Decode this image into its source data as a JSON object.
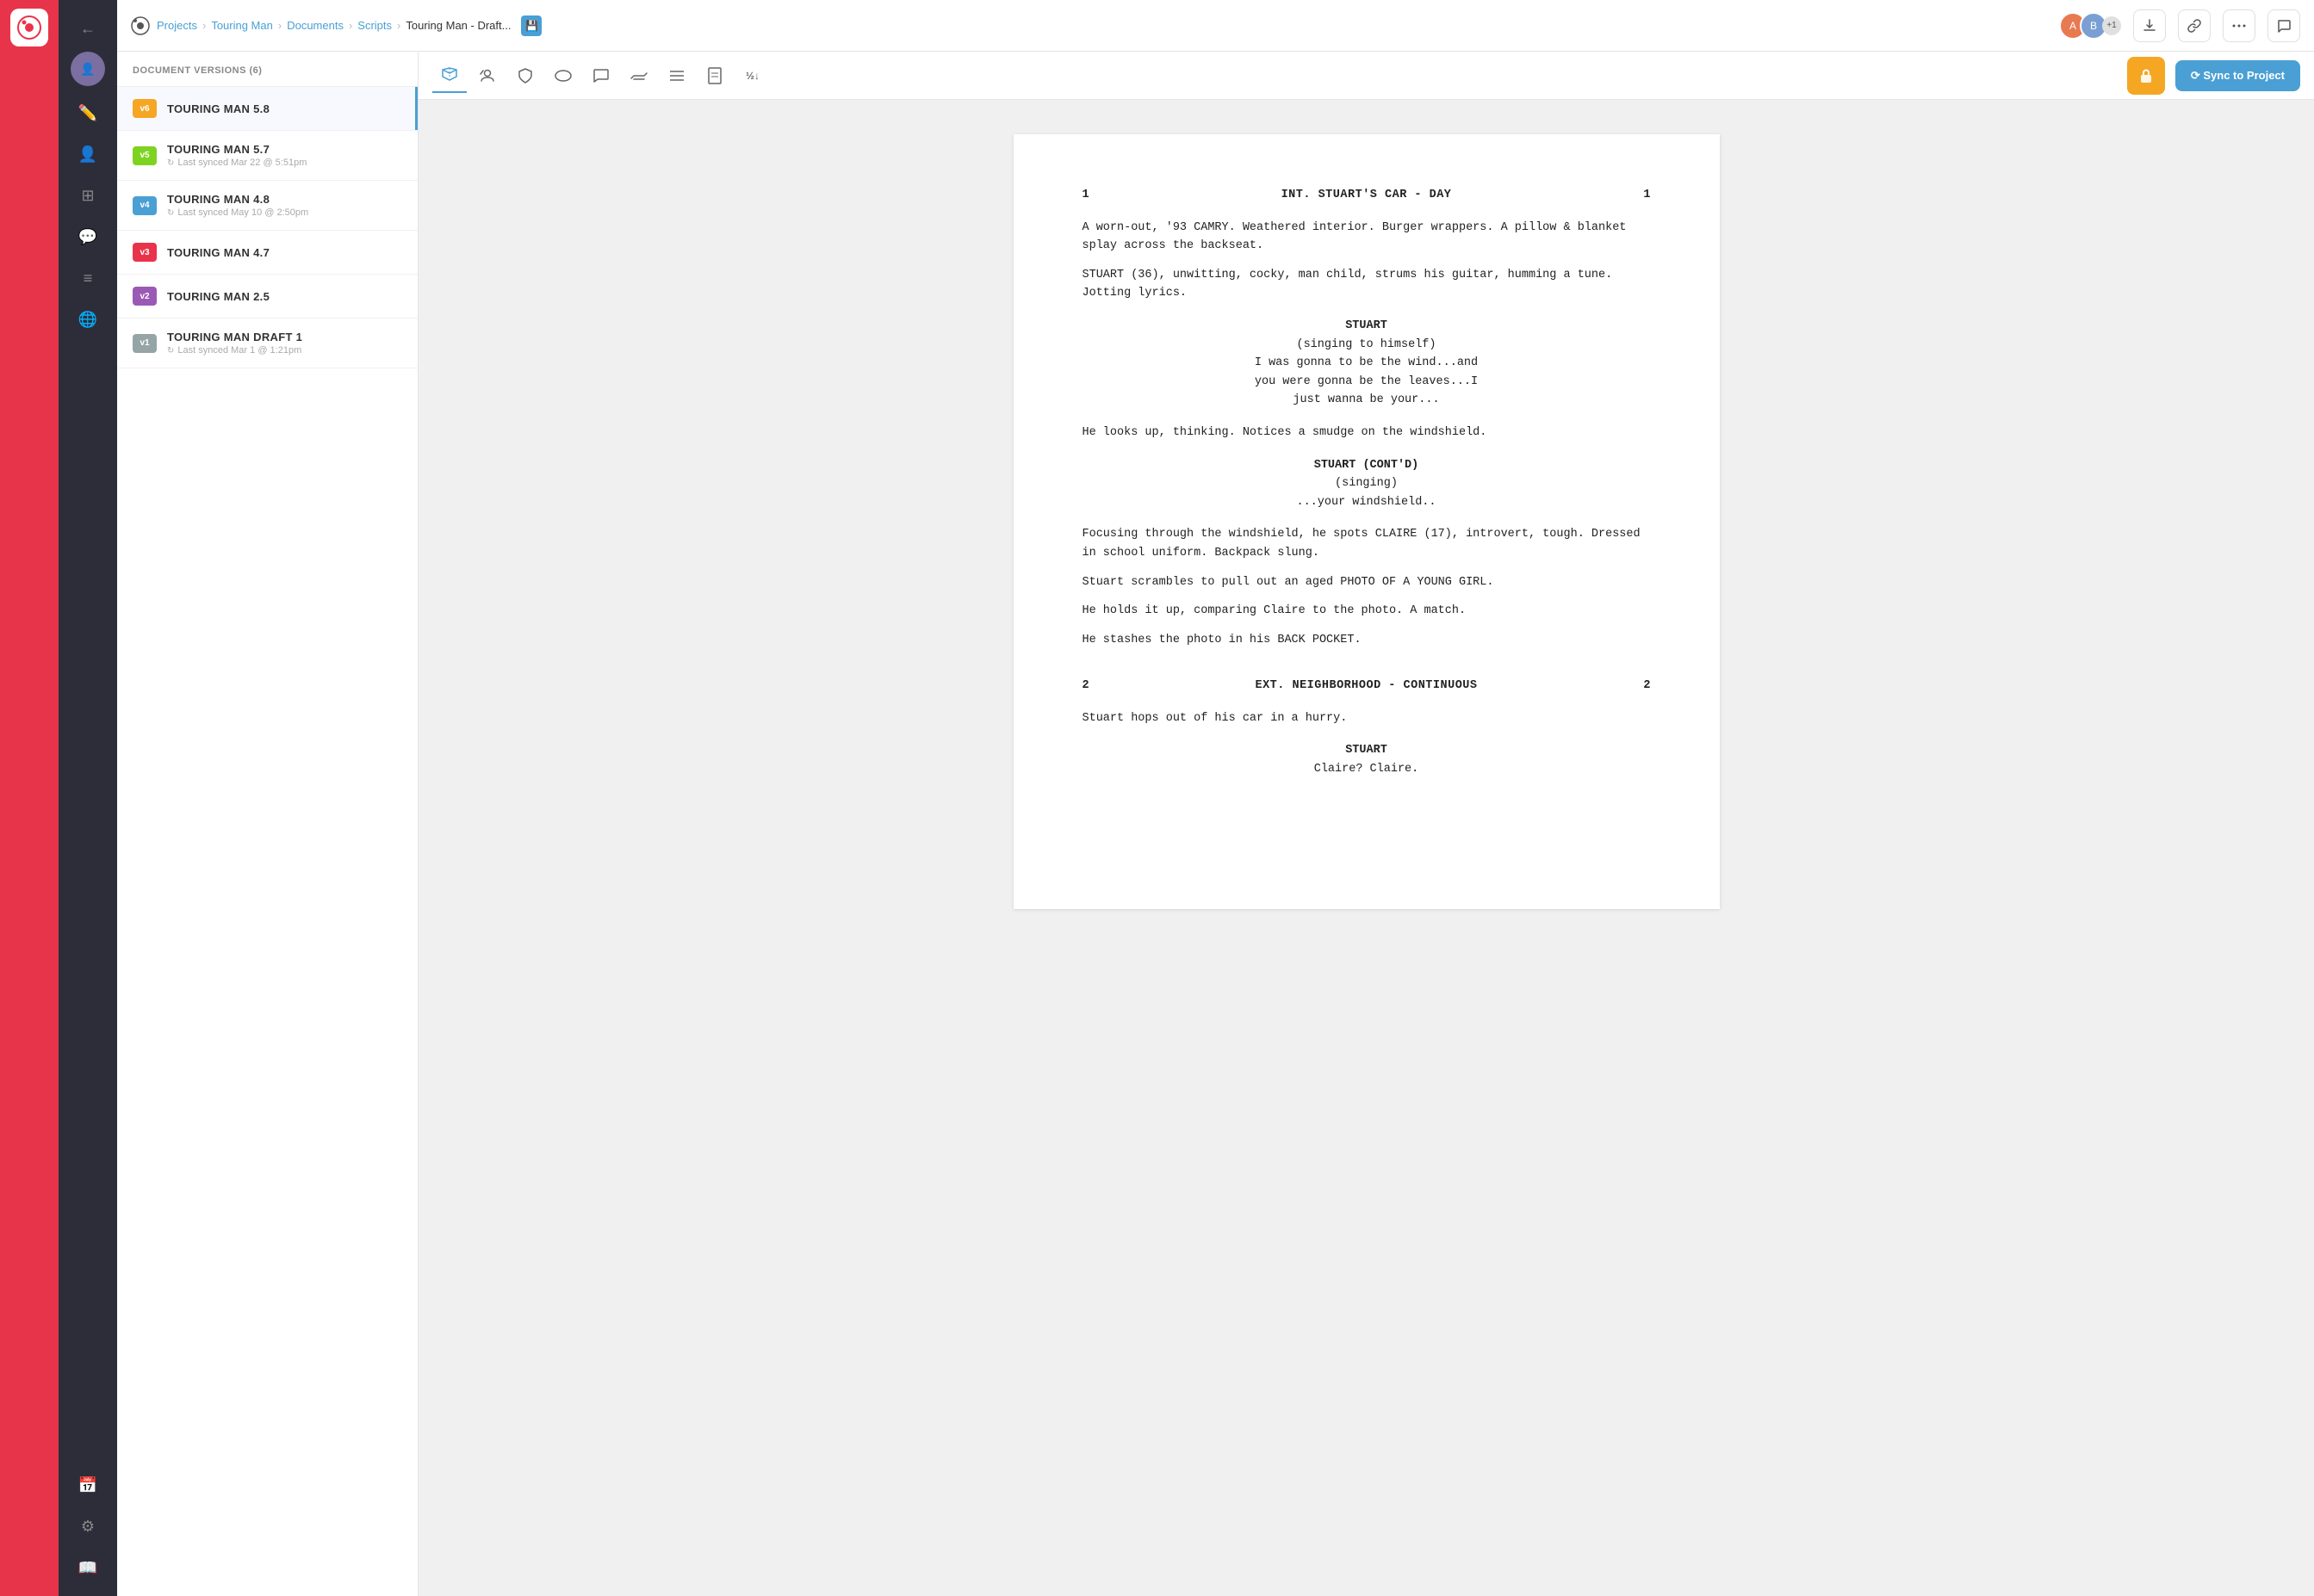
{
  "app": {
    "logo_alt": "Celtx logo"
  },
  "header": {
    "breadcrumbs": [
      "Projects",
      "Touring Man",
      "Documents",
      "Scripts",
      "Touring Man - Draft..."
    ],
    "breadcrumb_links": [
      "Projects",
      "Touring Man",
      "Documents",
      "Scripts"
    ],
    "breadcrumb_current": "Touring Man - Draft...",
    "save_icon": "💾",
    "avatars": [
      {
        "initials": "A",
        "color": "#e87a52"
      },
      {
        "initials": "B",
        "color": "#7a9fd4"
      }
    ],
    "avatar_count": "+1",
    "btn_download": "⬇",
    "btn_link": "🔗",
    "btn_more": "•••",
    "btn_chat": "💬"
  },
  "versions_panel": {
    "title": "DOCUMENT VERSIONS (6)",
    "versions": [
      {
        "badge": "v6",
        "badge_class": "badge-v6",
        "name": "TOURING MAN 5.8",
        "sync": null
      },
      {
        "badge": "v5",
        "badge_class": "badge-v5",
        "name": "TOURING MAN 5.7",
        "sync": "Last synced Mar 22 @ 5:51pm"
      },
      {
        "badge": "v4",
        "badge_class": "badge-v4",
        "name": "TOURING MAN 4.8",
        "sync": "Last synced May 10 @ 2:50pm"
      },
      {
        "badge": "v3",
        "badge_class": "badge-v3",
        "name": "TOURING MAN 4.7",
        "sync": null
      },
      {
        "badge": "v2",
        "badge_class": "badge-v2",
        "name": "TOURING MAN 2.5",
        "sync": null
      },
      {
        "badge": "v1",
        "badge_class": "badge-v1",
        "name": "TOURING MAN DRAFT 1",
        "sync": "Last synced Mar 1 @ 1:21pm"
      }
    ]
  },
  "toolbar": {
    "buttons": [
      {
        "icon": "⛰",
        "name": "scenes-btn",
        "active": true
      },
      {
        "icon": "📣",
        "name": "characters-btn",
        "active": false
      },
      {
        "icon": "🛡",
        "name": "breakdown-btn",
        "active": false
      },
      {
        "icon": "◯",
        "name": "elements-btn",
        "active": false
      },
      {
        "icon": "◯",
        "name": "notes-btn",
        "active": false
      },
      {
        "icon": "⇄",
        "name": "revisions-btn",
        "active": false
      },
      {
        "icon": "≡",
        "name": "outline-btn",
        "active": false
      },
      {
        "icon": "🖊",
        "name": "pages-btn",
        "active": false
      },
      {
        "icon": "½↓",
        "name": "compress-btn",
        "active": false
      }
    ],
    "lock_label": "🔒",
    "sync_label": "⟳ Sync to Project"
  },
  "script": {
    "scenes": [
      {
        "number": "1",
        "heading": "INT. STUART'S CAR - DAY",
        "page_number": "1",
        "paragraphs": [
          "A worn-out, '93 CAMRY. Weathered interior. Burger wrappers. A pillow & blanket splay across the backseat.",
          "STUART (36), unwitting, cocky, man child, strums his guitar, humming a tune. Jotting lyrics."
        ],
        "dialogue_blocks": [
          {
            "character": "STUART",
            "parenthetical": "(singing to himself)",
            "lines": "I was gonna to be the wind...and\nyou were gonna be the leaves...I\njust wanna be your..."
          }
        ],
        "paragraphs_after": [
          "He looks up, thinking. Notices a smudge on the windshield."
        ],
        "dialogue_blocks_2": [
          {
            "character": "STUART (CONT'D)",
            "parenthetical": "(singing)",
            "lines": "...your windshield.."
          }
        ],
        "paragraphs_final": [
          "Focusing through the windshield, he spots CLAIRE (17), introvert, tough. Dressed in school uniform. Backpack slung.",
          "Stuart scrambles to pull out an aged PHOTO OF A YOUNG GIRL.",
          "He holds it up, comparing Claire to the photo. A match.",
          "He stashes the photo in his BACK POCKET."
        ]
      },
      {
        "number": "2",
        "heading": "EXT. NEIGHBORHOOD - CONTINUOUS",
        "page_number": "2",
        "paragraphs": [
          "Stuart hops out of his car in a hurry."
        ],
        "dialogue_blocks": [
          {
            "character": "STUART",
            "parenthetical": null,
            "lines": "Claire? Claire."
          }
        ]
      }
    ]
  }
}
